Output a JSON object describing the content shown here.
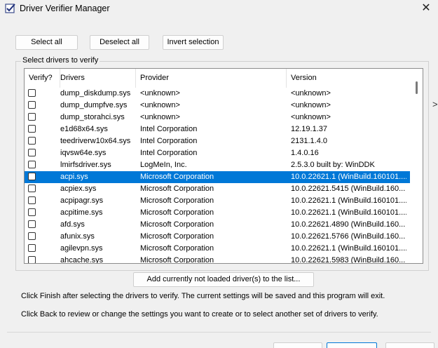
{
  "window": {
    "title": "Driver Verifier Manager"
  },
  "toolbar": {
    "select_all": "Select all",
    "deselect_all": "Deselect all",
    "invert_selection": "Invert selection"
  },
  "group": {
    "label": "Select drivers to verify"
  },
  "table": {
    "columns": [
      "Verify?",
      "Drivers",
      "Provider",
      "Version"
    ],
    "rows": [
      {
        "driver": "dump_diskdump.sys",
        "provider": "<unknown>",
        "version": "<unknown>",
        "checked": false,
        "selected": false
      },
      {
        "driver": "dump_dumpfve.sys",
        "provider": "<unknown>",
        "version": "<unknown>",
        "checked": false,
        "selected": false
      },
      {
        "driver": "dump_storahci.sys",
        "provider": "<unknown>",
        "version": "<unknown>",
        "checked": false,
        "selected": false
      },
      {
        "driver": "e1d68x64.sys",
        "provider": "Intel Corporation",
        "version": "12.19.1.37",
        "checked": false,
        "selected": false
      },
      {
        "driver": "teedriverw10x64.sys",
        "provider": "Intel Corporation",
        "version": "2131.1.4.0",
        "checked": false,
        "selected": false
      },
      {
        "driver": "iqvsw64e.sys",
        "provider": "Intel Corporation",
        "version": "1.4.0.16",
        "checked": false,
        "selected": false
      },
      {
        "driver": "lmirfsdriver.sys",
        "provider": "LogMeIn, Inc.",
        "version": "2.5.3.0 built by: WinDDK",
        "checked": false,
        "selected": false
      },
      {
        "driver": "acpi.sys",
        "provider": "Microsoft Corporation",
        "version": "10.0.22621.1 (WinBuild.160101....",
        "checked": false,
        "selected": true
      },
      {
        "driver": "acpiex.sys",
        "provider": "Microsoft Corporation",
        "version": "10.0.22621.5415 (WinBuild.160...",
        "checked": false,
        "selected": false
      },
      {
        "driver": "acpipagr.sys",
        "provider": "Microsoft Corporation",
        "version": "10.0.22621.1 (WinBuild.160101....",
        "checked": false,
        "selected": false
      },
      {
        "driver": "acpitime.sys",
        "provider": "Microsoft Corporation",
        "version": "10.0.22621.1 (WinBuild.160101....",
        "checked": false,
        "selected": false
      },
      {
        "driver": "afd.sys",
        "provider": "Microsoft Corporation",
        "version": "10.0.22621.4890 (WinBuild.160...",
        "checked": false,
        "selected": false
      },
      {
        "driver": "afunix.sys",
        "provider": "Microsoft Corporation",
        "version": "10.0.22621.5766 (WinBuild.160...",
        "checked": false,
        "selected": false
      },
      {
        "driver": "agilevpn.sys",
        "provider": "Microsoft Corporation",
        "version": "10.0.22621.1 (WinBuild.160101....",
        "checked": false,
        "selected": false
      },
      {
        "driver": "ahcache.sys",
        "provider": "Microsoft Corporation",
        "version": "10.0.22621.5983 (WinBuild.160...",
        "checked": false,
        "selected": false
      }
    ]
  },
  "add_button": {
    "label": "Add currently not loaded driver(s) to the list..."
  },
  "info": {
    "line1": "Click Finish after selecting the drivers to verify. The current settings will be saved and this program will exit.",
    "line2": "Click Back to review or change the settings you want to create or to select another set of drivers to verify."
  },
  "colors": {
    "selection": "#0078d7",
    "window_bg": "#f0f0f0"
  },
  "icons": {
    "app": "checklist-icon",
    "close": "close-icon",
    "cursor": "resize-cursor-icon"
  }
}
